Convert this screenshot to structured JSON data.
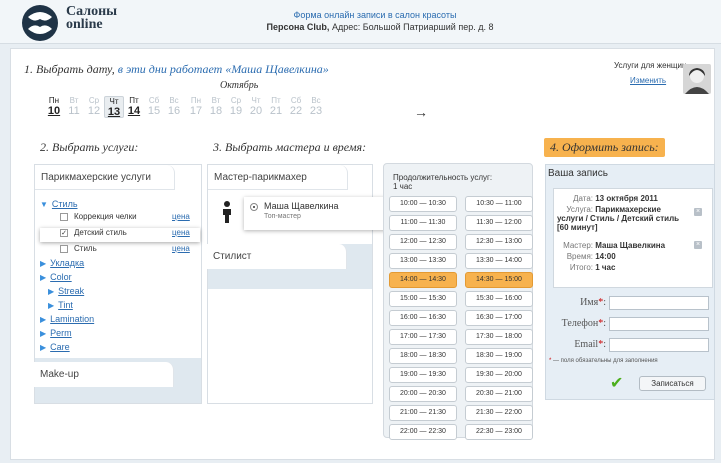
{
  "header": {
    "brand_line1": "Салоны",
    "brand_line2": "online",
    "title": "Форма онлайн записи в салон красоты",
    "salon_name": "Персона Club,",
    "address": "Адрес: Большой Патриарший пер. д. 8"
  },
  "step1": {
    "prefix": "1. Выбрать дату,",
    "link": "в эти дни работает «Маша Щавелкина»"
  },
  "calendar": {
    "month": "Октябрь",
    "days": [
      {
        "wd": "Пн",
        "n": "10",
        "active": true,
        "selected": false
      },
      {
        "wd": "Вт",
        "n": "11",
        "active": false,
        "selected": false
      },
      {
        "wd": "Ср",
        "n": "12",
        "active": false,
        "selected": false
      },
      {
        "wd": "Чт",
        "n": "13",
        "active": true,
        "selected": true
      },
      {
        "wd": "Пт",
        "n": "14",
        "active": true,
        "selected": false
      },
      {
        "wd": "Сб",
        "n": "15",
        "active": false,
        "selected": false
      },
      {
        "wd": "Вс",
        "n": "16",
        "active": false,
        "selected": false
      },
      {
        "wd": "Пн",
        "n": "17",
        "active": false,
        "selected": false
      },
      {
        "wd": "Вт",
        "n": "18",
        "active": false,
        "selected": false
      },
      {
        "wd": "Ср",
        "n": "19",
        "active": false,
        "selected": false
      },
      {
        "wd": "Чт",
        "n": "20",
        "active": false,
        "selected": false
      },
      {
        "wd": "Пт",
        "n": "21",
        "active": false,
        "selected": false
      },
      {
        "wd": "Сб",
        "n": "22",
        "active": false,
        "selected": false
      },
      {
        "wd": "Вс",
        "n": "23",
        "active": false,
        "selected": false
      }
    ],
    "next": "→"
  },
  "services_for": "Услуги для женщин",
  "change_link": "Изменить",
  "step2": "2. Выбрать услуги:",
  "step3": "3. Выбрать мастера и время:",
  "step4": "4. Оформить запись:",
  "services": {
    "tab1": "Парикмахерские услуги",
    "tab2": "Make-up",
    "cat_open": "Стиль",
    "subitems": [
      {
        "label": "Коррекция челки",
        "price": "цена",
        "checked": false
      },
      {
        "label": "Детский стиль",
        "price": "цена",
        "checked": true
      },
      {
        "label": "Стиль",
        "price": "цена",
        "checked": false
      }
    ],
    "categories": [
      "Укладка",
      "Color",
      "Streak",
      "Tint",
      "Lamination",
      "Perm",
      "Care"
    ]
  },
  "masters": {
    "group1": "Мастер-парикмахер",
    "master_name": "Маша Щавелкина",
    "master_role": "Топ-мастер",
    "group2": "Стилист"
  },
  "times": {
    "duration_label": "Продолжительность услуг:",
    "duration_value": "1 час",
    "slots": [
      [
        "10:00 — 10:30",
        "10:30 — 11:00"
      ],
      [
        "11:00 — 11:30",
        "11:30 — 12:00"
      ],
      [
        "12:00 — 12:30",
        "12:30 — 13:00"
      ],
      [
        "13:00 — 13:30",
        "13:30 — 14:00"
      ],
      [
        "14:00 — 14:30",
        "14:30 — 15:00"
      ],
      [
        "15:00 — 15:30",
        "15:30 — 16:00"
      ],
      [
        "16:00 — 16:30",
        "16:30 — 17:00"
      ],
      [
        "17:00 — 17:30",
        "17:30 — 18:00"
      ],
      [
        "18:00 — 18:30",
        "18:30 — 19:00"
      ],
      [
        "19:00 — 19:30",
        "19:30 — 20:00"
      ],
      [
        "20:00 — 20:30",
        "20:30 — 21:00"
      ],
      [
        "21:00 — 21:30",
        "21:30 — 22:00"
      ],
      [
        "22:00 — 22:30",
        "22:30 — 23:00"
      ]
    ],
    "selected_row": 4
  },
  "booking": {
    "title": "Ваша запись",
    "date_label": "Дата:",
    "date_value": "13 октября 2011",
    "service_label": "Услуга:",
    "service_value": "Парикмахерские услуги / Стиль / Детский стиль [60 минут]",
    "master_label": "Мастер:",
    "master_value": "Маша Щавелкина",
    "time_label": "Время:",
    "time_value": "14:00",
    "total_label": "Итого:",
    "total_value": "1 час",
    "name_label": "Имя",
    "phone_label": "Телефон",
    "email_label": "Email",
    "required_mark": "*",
    "required_note": "— поля обязательны для заполнения",
    "submit": "Записаться"
  },
  "colors": {
    "accent": "#2b6cb0",
    "highlight": "#f7b24e"
  }
}
